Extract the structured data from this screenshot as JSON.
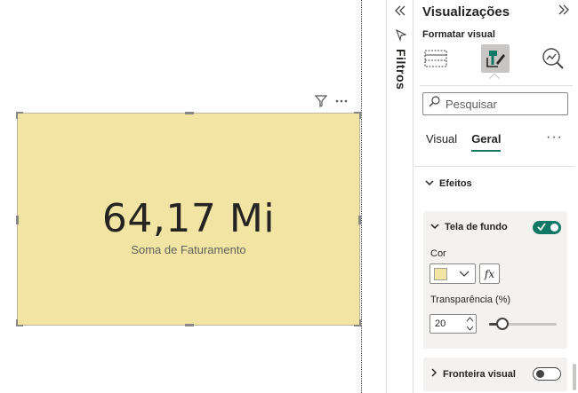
{
  "canvas": {
    "card": {
      "value": "64,17 Mi",
      "label": "Soma de Faturamento",
      "background_color": "#f2e5a3"
    },
    "header_icons": [
      "filter-icon",
      "more-options-icon"
    ]
  },
  "filters_pane": {
    "label": "Filtros",
    "icons": [
      "collapse-left-icon",
      "funnel-icon"
    ]
  },
  "visualizations_pane": {
    "title": "Visualizações",
    "subtitle": "Formatar visual",
    "search": {
      "placeholder": "Pesquisar"
    },
    "tabs": [
      {
        "label": "Visual",
        "active": false
      },
      {
        "label": "Geral",
        "active": true
      }
    ],
    "more_label": "···",
    "sections": {
      "effects": {
        "label": "Efeitos",
        "expanded": true
      },
      "background": {
        "label": "Tela de fundo",
        "enabled": true,
        "color_label": "Cor",
        "color_value": "#f2e5a3",
        "fx_label": "fx",
        "transparency_label": "Transparência (%)",
        "transparency_value": "20",
        "transparency_percent": 20
      },
      "border": {
        "label": "Fronteira visual",
        "enabled": false
      }
    },
    "accent_color": "#117865"
  }
}
